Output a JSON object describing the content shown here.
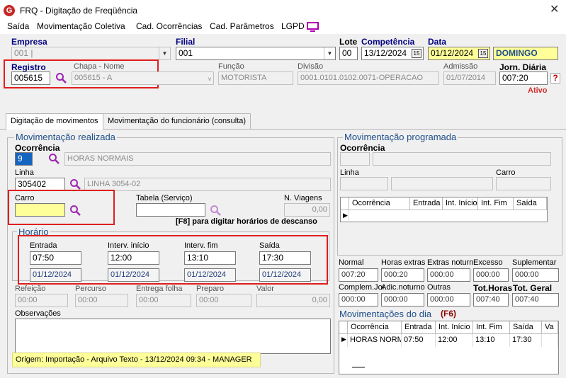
{
  "window": {
    "title": "FRQ - Digitação de Freqüência",
    "close": "✕"
  },
  "menu": [
    "Saída",
    "Movimentação Coletiva",
    "Cad. Ocorrências",
    "Cad. Parâmetros",
    "LGPD"
  ],
  "header": {
    "empresa_label": "Empresa",
    "empresa_value": "001 |",
    "filial_label": "Filial",
    "filial_value": "001",
    "lote_label": "Lote",
    "lote_value": "00",
    "competencia_label": "Competência",
    "competencia_value": "13/12/2024",
    "data_label": "Data",
    "data_value": "01/12/2024",
    "weekday": "DOMINGO",
    "registro_label": "Registro",
    "registro_value": "005615",
    "chapa_label": "Chapa  -  Nome",
    "chapa_value": "005615 - A",
    "funcao_label": "Função",
    "funcao_value": "MOTORISTA",
    "divisao_label": "Divisão",
    "divisao_value": "0001.0101.0102.0071-OPERACAO",
    "admissao_label": "Admissão",
    "admissao_value": "01/07/2014",
    "jornada_label": "Jorn. Diária",
    "jornada_value": "007:20",
    "help": "?",
    "status": "Ativo"
  },
  "tabs": [
    "Digitação de movimentos",
    "Movimentação do funcionário (consulta)"
  ],
  "realizada": {
    "title": "Movimentação realizada",
    "ocorrencia_label": "Ocorrência",
    "ocorrencia_code": "9",
    "ocorrencia_desc": "HORAS NORMAIS",
    "linha_label": "Linha",
    "linha_code": "305402",
    "linha_desc": "LINHA 3054-02",
    "carro_label": "Carro",
    "carro_value": "",
    "tabela_label": "Tabela (Serviço)",
    "tabela_value": "",
    "viagens_label": "N. Viagens",
    "viagens_value": "0,00",
    "f8_hint": "[F8] para digitar horários de descanso",
    "horario_title": "Horário",
    "entrada_label": "Entrada",
    "entrada_time": "07:50",
    "entrada_date": "01/12/2024",
    "intini_label": "Interv. início",
    "intini_time": "12:00",
    "intini_date": "01/12/2024",
    "intfim_label": "Interv. fim",
    "intfim_time": "13:10",
    "intfim_date": "01/12/2024",
    "saida_label": "Saída",
    "saida_time": "17:30",
    "saida_date": "01/12/2024",
    "refeicao_label": "Refeição",
    "refeicao_value": "00:00",
    "percurso_label": "Percurso",
    "percurso_value": "00:00",
    "entrega_label": "Entrega folha",
    "entrega_value": "00:00",
    "preparo_label": "Preparo",
    "preparo_value": "00:00",
    "valor_label": "Valor",
    "valor_value": "0,00",
    "obs_label": "Observações",
    "obs_value": "",
    "origem": "Origem: Importação - Arquivo Texto - 13/12/2024 09:34 - MANAGER"
  },
  "programada": {
    "title": "Movimentação programada",
    "ocorrencia_label": "Ocorrência",
    "linha_label": "Linha",
    "carro_label": "Carro",
    "grid_headers": [
      "Ocorrência",
      "Entrada",
      "Int. Início",
      "Int. Fim",
      "Saída"
    ]
  },
  "totals": {
    "normal_label": "Normal",
    "normal_value": "007:20",
    "extras_label": "Horas extras",
    "extras_value": "000:20",
    "extnot_label": "Extras noturn.",
    "extnot_value": "000:00",
    "excesso_label": "Excesso",
    "excesso_value": "000:00",
    "suplementar_label": "Suplementar",
    "suplementar_value": "000:00",
    "complem_label": "Complem.Jor.",
    "complem_value": "000:00",
    "adicnot_label": "Adic.noturno",
    "adicnot_value": "000:00",
    "outras_label": "Outras",
    "outras_value": "000:00",
    "tothoras_label": "Tot.Horas",
    "tothoras_value": "007:40",
    "totgeral_label": "Tot. Geral",
    "totgeral_value": "007:40"
  },
  "dia": {
    "title": "Movimentações do dia",
    "shortcut": "(F6)",
    "headers": [
      "Ocorrência",
      "Entrada",
      "Int. Início",
      "Int. Fim",
      "Saída",
      "Va"
    ],
    "row": [
      "HORAS NORM",
      "07:50",
      "12:00",
      "13:10",
      "17:30",
      ""
    ]
  },
  "colors": {
    "accent": "#000080",
    "highlight": "#ffff99",
    "red": "#e01e1e",
    "group_title": "#1f4e8a"
  }
}
